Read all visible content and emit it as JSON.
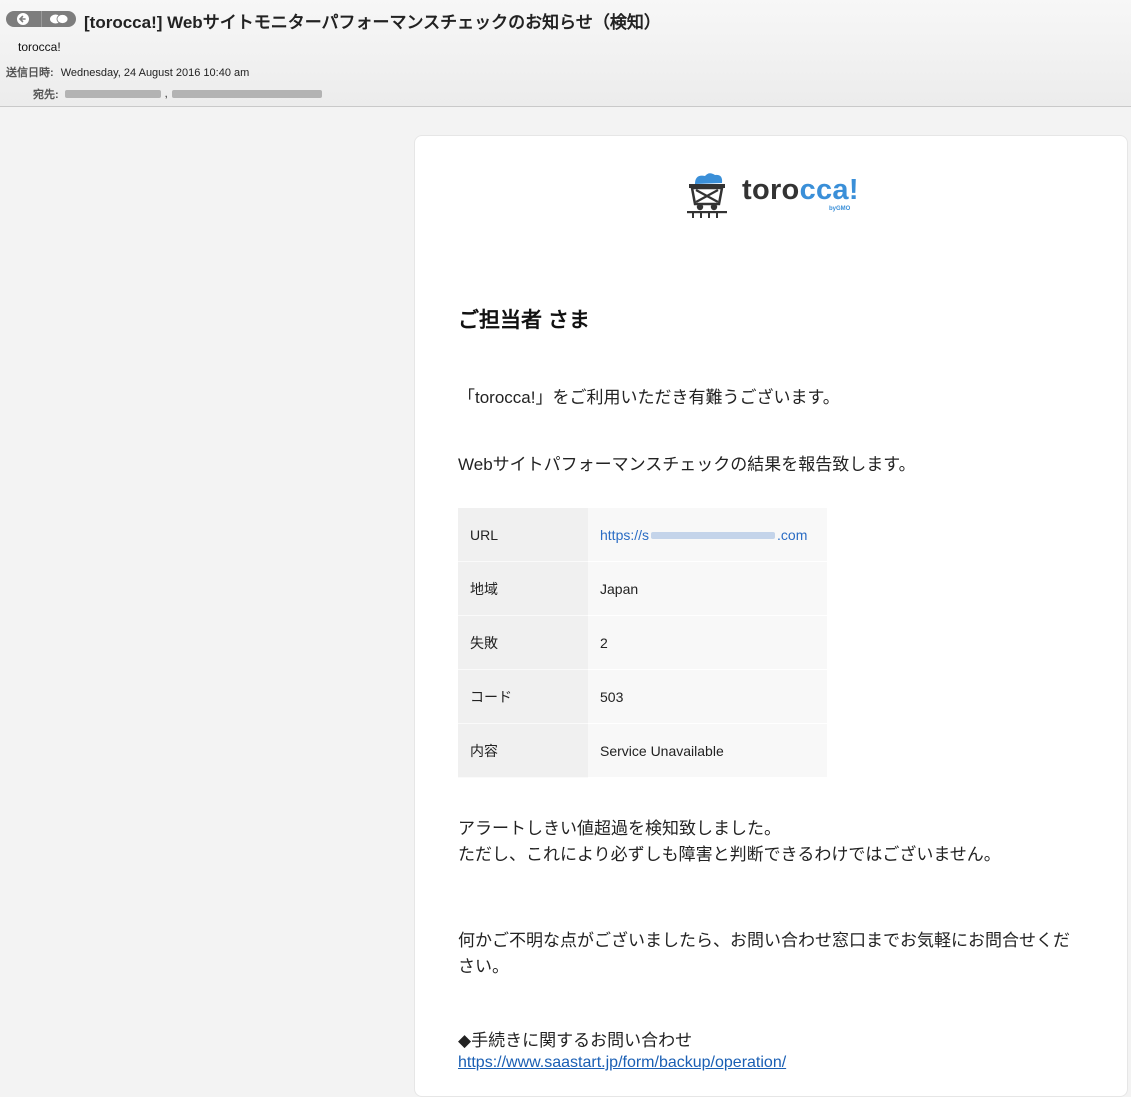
{
  "header": {
    "subject": "[torocca!] Webサイトモニターパフォーマンスチェックのお知らせ（検知）",
    "sender": "torocca!",
    "date_label": "送信日時:",
    "date_value": "Wednesday, 24 August 2016 10:40 am",
    "to_label": "宛先:",
    "nav_icons": [
      "arrow-left-icon",
      "speech-bubbles-icon"
    ]
  },
  "email": {
    "logo": {
      "text_a": "toro",
      "text_b": "cca",
      "text_c": "!",
      "sub": "byGMO"
    },
    "greeting": "ご担当者 さま",
    "thanks": "「torocca!」をご利用いただき有難うございます。",
    "report": "Webサイトパフォーマンスチェックの結果を報告致します。",
    "table": [
      {
        "label": "URL",
        "value": "https://s",
        "value_end": ".com"
      },
      {
        "label": "地域",
        "value": "Japan"
      },
      {
        "label": "失敗",
        "value": "2"
      },
      {
        "label": "コード",
        "value": "503"
      },
      {
        "label": "内容",
        "value": "Service Unavailable"
      }
    ],
    "alert_line1": "アラートしきい値超過を検知致しました。",
    "alert_line2": "ただし、これにより必ずしも障害と判断できるわけではございません。",
    "contact": "何かご不明な点がございましたら、お問い合わせ窓口までお気軽にお問合せください。",
    "procedure_label": "◆手続きに関するお問い合わせ",
    "procedure_link": "https://www.saastart.jp/form/backup/operation/"
  },
  "colors": {
    "link": "#1a5fb4",
    "accent": "#3a8fd8"
  }
}
